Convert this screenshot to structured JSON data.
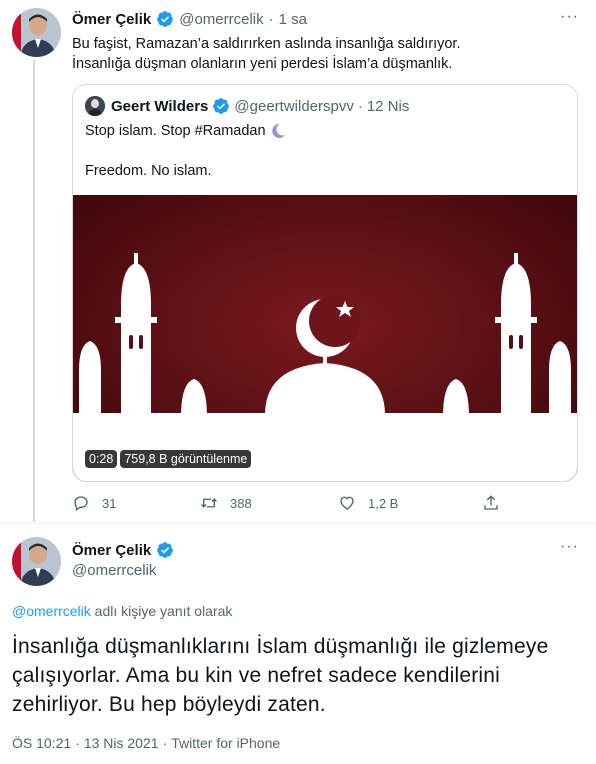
{
  "top_tweet": {
    "author_name": "Ömer Çelik",
    "author_handle": "@omerrcelik",
    "dot": "·",
    "time": "1 sa",
    "more": "···",
    "text_line1": "Bu faşist, Ramazan’a saldırırken aslında insanlığa saldırıyor.",
    "text_line2": "İnsanlığa düşman olanların yeni perdesi İslam’a düşmanlık."
  },
  "quoted_tweet": {
    "author_name": "Geert Wilders",
    "author_handle": "@geertwilderspvv",
    "dot": "·",
    "time": "12 Nis",
    "text_line1": "Stop islam. Stop #Ramadan",
    "text_line2": "Freedom. No islam.",
    "video_duration": "0:28",
    "video_views": "759,8 B görüntülenme"
  },
  "actions": {
    "replies": "31",
    "retweets": "388",
    "likes": "1,2 B"
  },
  "main_tweet": {
    "author_name": "Ömer Çelik",
    "author_handle": "@omerrcelik",
    "more": "···",
    "reply_to_handle": "@omerrcelik",
    "reply_to_suffix": " adlı kişiye yanıt olarak",
    "text_line1": "İnsanlığa düşmanlıklarını İslam düşmanlığı ile gizlemeye",
    "text_line2": "çalışıyorlar. Ama bu kin ve nefret sadece kendilerini",
    "text_line3": "zehirliyor. Bu hep böyleydi zaten.",
    "time": "ÖS 10:21",
    "date": "13 Nis 2021",
    "source": "Twitter for iPhone",
    "dot": "·"
  },
  "colors": {
    "accent": "#1d9bf0",
    "secondary_text": "#536471",
    "border": "#cfd9de",
    "media_background": "#5a0f14"
  }
}
